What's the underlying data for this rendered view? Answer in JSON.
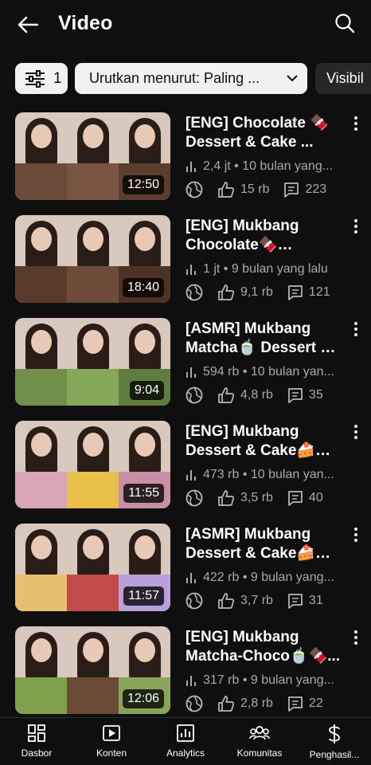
{
  "header": {
    "title": "Video"
  },
  "filters": {
    "filter_count": "1",
    "sort_label": "Urutkan menurut: Paling ...",
    "visibility_label": "Visibil"
  },
  "videos": [
    {
      "title": "[ENG] Chocolate 🍫 Dessert & Cake ...",
      "duration": "12:50",
      "meta": "2,4 jt • 10 bulan yang...",
      "likes": "15 rb",
      "comments": "223",
      "thumb_colors": [
        "#6b4a3a",
        "#7a5544",
        "#5c3e30"
      ]
    },
    {
      "title": "[ENG] Mukbang Chocolate🍫 Dessert...",
      "duration": "18:40",
      "meta": "1 jt • 9 bulan yang lalu",
      "likes": "9,1 rb",
      "comments": "121",
      "thumb_colors": [
        "#5a3a2a",
        "#6e4a38",
        "#4d3326"
      ]
    },
    {
      "title": "[ASMR] Mukbang Matcha🍵 Dessert & ...",
      "duration": "9:04",
      "meta": "594 rb • 10 bulan yan...",
      "likes": "4,8 rb",
      "comments": "35",
      "thumb_colors": [
        "#6f8f4a",
        "#86a85a",
        "#5f7d3e"
      ]
    },
    {
      "title": "[ENG] Mukbang Dessert & Cake🍰💛...",
      "duration": "11:55",
      "meta": "473 rb • 10 bulan yan...",
      "likes": "3,5 rb",
      "comments": "40",
      "thumb_colors": [
        "#d9a5b8",
        "#e8c04a",
        "#c98fa6"
      ]
    },
    {
      "title": "[ASMR] Mukbang Dessert & Cake🍰🍓...",
      "duration": "11:57",
      "meta": "422 rb • 9 bulan yang...",
      "likes": "3,7 rb",
      "comments": "31",
      "thumb_colors": [
        "#e6c070",
        "#c24a4a",
        "#b9a0d8"
      ]
    },
    {
      "title": "[ENG] Mukbang Matcha-Choco🍵🍫...",
      "duration": "12:06",
      "meta": "317 rb • 9 bulan yang...",
      "likes": "2,8 rb",
      "comments": "22",
      "thumb_colors": [
        "#7fa04a",
        "#6b4a36",
        "#8aa457"
      ]
    }
  ],
  "bottom_nav": [
    {
      "label": "Dasbor",
      "icon": "dashboard-icon"
    },
    {
      "label": "Konten",
      "icon": "content-icon"
    },
    {
      "label": "Analytics",
      "icon": "analytics-icon"
    },
    {
      "label": "Komunitas",
      "icon": "community-icon"
    },
    {
      "label": "Penghasil...",
      "icon": "earn-icon"
    }
  ],
  "colors": {
    "background": "#0f0f0f",
    "chip_light": "#f1f1f1",
    "chip_dark": "#272727",
    "secondary_text": "#aaaaaa"
  }
}
